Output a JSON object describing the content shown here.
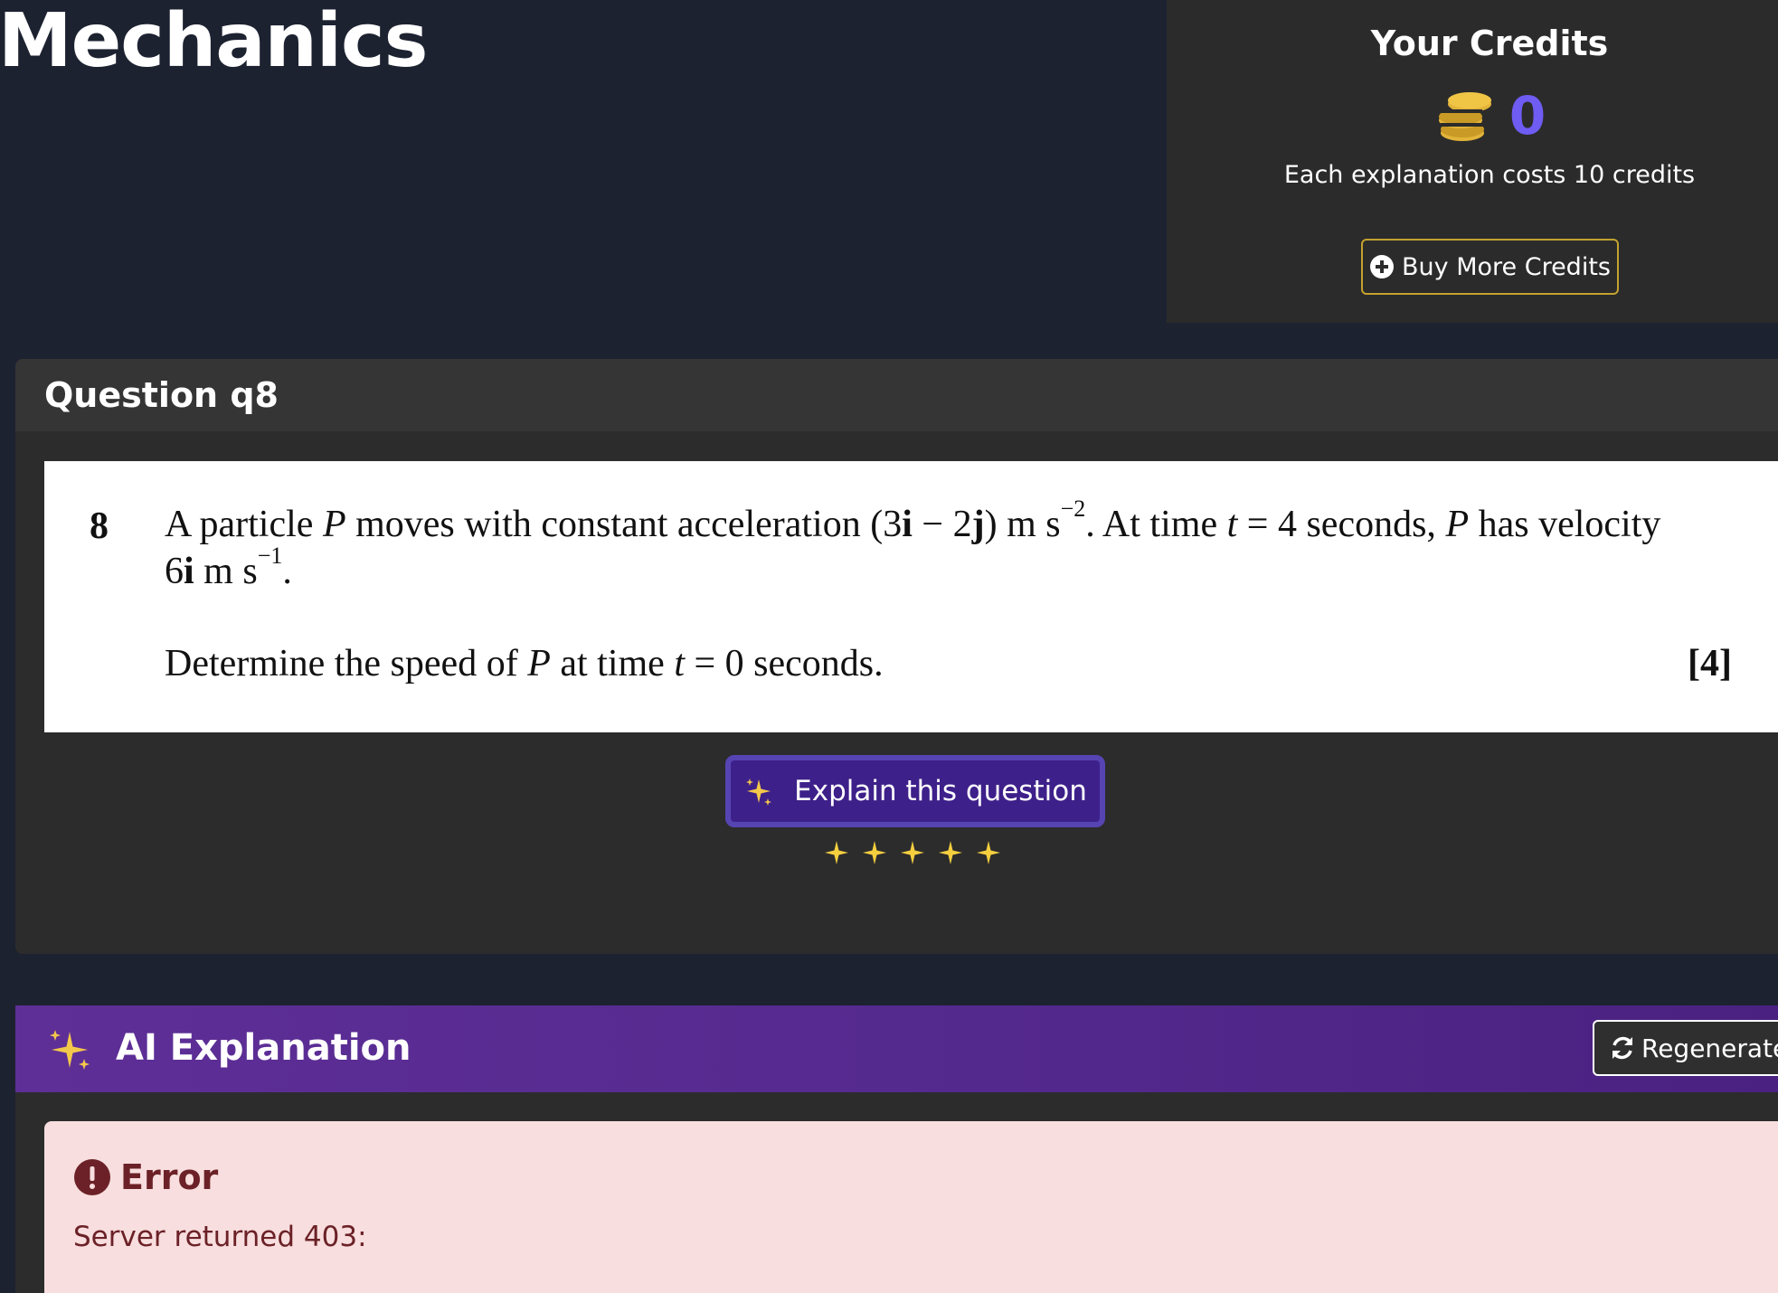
{
  "page": {
    "title": "Mechanics"
  },
  "credits": {
    "title": "Your Credits",
    "balance": "0",
    "note": "Each explanation costs 10 credits",
    "buy_label": "Buy More Credits",
    "icon": "coins-icon",
    "accent_color": "#6f5cf2",
    "coin_color": "#e2b43a"
  },
  "question": {
    "header": "Question q8",
    "number": "8",
    "marks": "[4]",
    "explain_label": "Explain this question",
    "loading_stars": 5
  },
  "ai_explanation": {
    "title": "AI Explanation",
    "regenerate_label": "Regenerate",
    "error": {
      "title": "Error",
      "message": "Server returned 403:"
    }
  },
  "colors": {
    "page_bg": "#1d2231",
    "card_bg": "#2c2c2c",
    "ai_header": "#5e2f97",
    "explain_button": "#3e208a",
    "buy_border": "#c3a22f",
    "error_bg": "#f8dede",
    "error_text": "#6b2127"
  }
}
